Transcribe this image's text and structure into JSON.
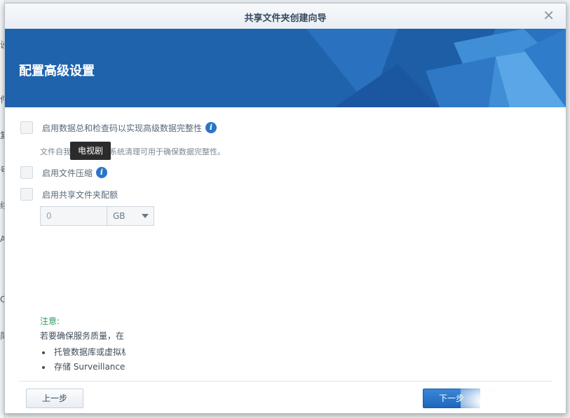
{
  "background": {
    "edge_glyphs": [
      "设",
      "件",
      "复",
      "号",
      "续",
      "A",
      "C",
      "简"
    ]
  },
  "dialog": {
    "title": "共享文件夹创建向导",
    "close_icon": "close-icon",
    "banner_title": "配置高级设置",
    "options": [
      {
        "label": "启用数据总和检查码以实现高级数据完整性",
        "checked": false,
        "has_info": true
      },
      {
        "label": "启用文件压缩",
        "checked": false,
        "has_info": true
      },
      {
        "label": "启用共享文件夹配额",
        "checked": false,
        "has_info": false
      }
    ],
    "checksum_description": "文件自我修复和文件系统清理可用于确保数据完整性。",
    "tooltip": "电视剧",
    "quota": {
      "value": "0",
      "unit": "GB"
    },
    "note": {
      "title": "注意:",
      "text": "若要确保服务质量，在",
      "bullets": [
        "托管数据库或虚拟机",
        "存储 Surveillance"
      ]
    },
    "buttons": {
      "prev": "上一步",
      "next": "下一步"
    },
    "colors": {
      "banner": "#1f63ad",
      "primary_button": "#2a75c9",
      "note_title": "#2c9a63"
    }
  }
}
